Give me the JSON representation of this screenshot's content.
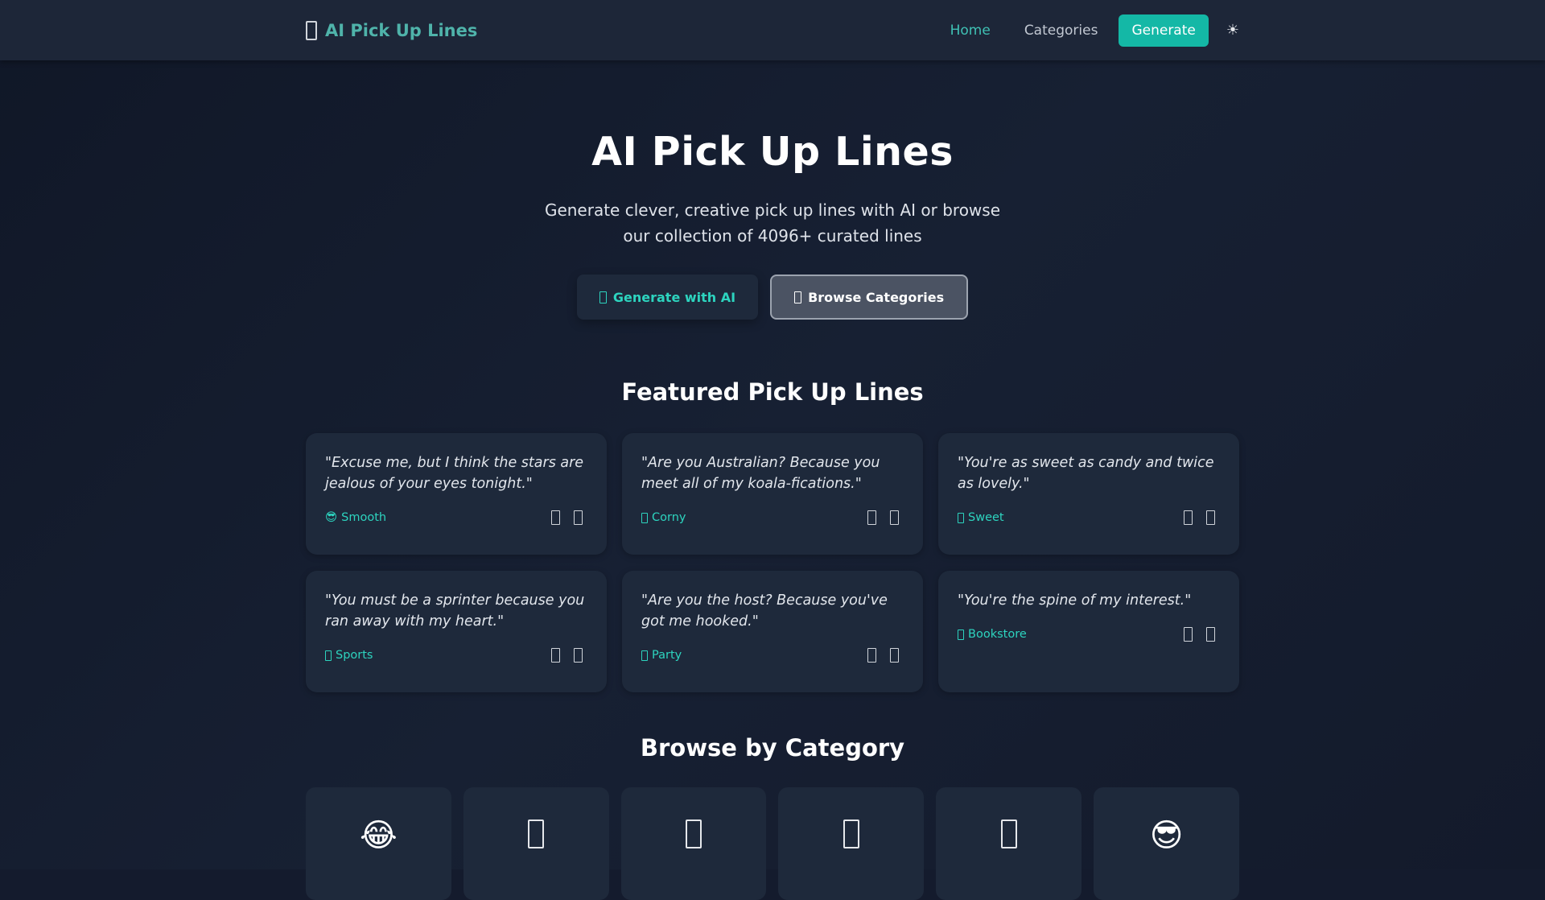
{
  "nav": {
    "brand": "AI Pick Up Lines",
    "links": [
      "Home",
      "Categories"
    ],
    "cta": "Generate",
    "theme_toggle": "☀"
  },
  "hero": {
    "title": "AI Pick Up Lines",
    "subtitle": "Generate clever, creative pick up lines with AI or browse our collection of 4096+ curated lines",
    "primary_button": "Generate with AI",
    "secondary_button": "Browse Categories"
  },
  "featured": {
    "title": "Featured Pick Up Lines",
    "cards": [
      {
        "line": "\"Excuse me, but I think the stars are jealous of your eyes tonight.\"",
        "tag_icon": "😎",
        "tag": "Smooth"
      },
      {
        "line": "\"Are you Australian? Because you meet all of my koala-fications.\"",
        "tag_icon": "",
        "tag": "Corny"
      },
      {
        "line": "\"You're as sweet as candy and twice as lovely.\"",
        "tag_icon": "",
        "tag": "Sweet"
      },
      {
        "line": "\"You must be a sprinter because you ran away with my heart.\"",
        "tag_icon": "",
        "tag": "Sports"
      },
      {
        "line": "\"Are you the host? Because you've got me hooked.\"",
        "tag_icon": "",
        "tag": "Party"
      },
      {
        "line": "\"You're the spine of my interest.\"",
        "tag_icon": "",
        "tag": "Bookstore"
      }
    ]
  },
  "categories": {
    "title": "Browse by Category",
    "icons": [
      "😂",
      "",
      "",
      "",
      "",
      "😎"
    ]
  },
  "colors": {
    "accent": "#14b8a6",
    "card_bg": "#1e293b",
    "nav_bg": "#1d2638"
  }
}
